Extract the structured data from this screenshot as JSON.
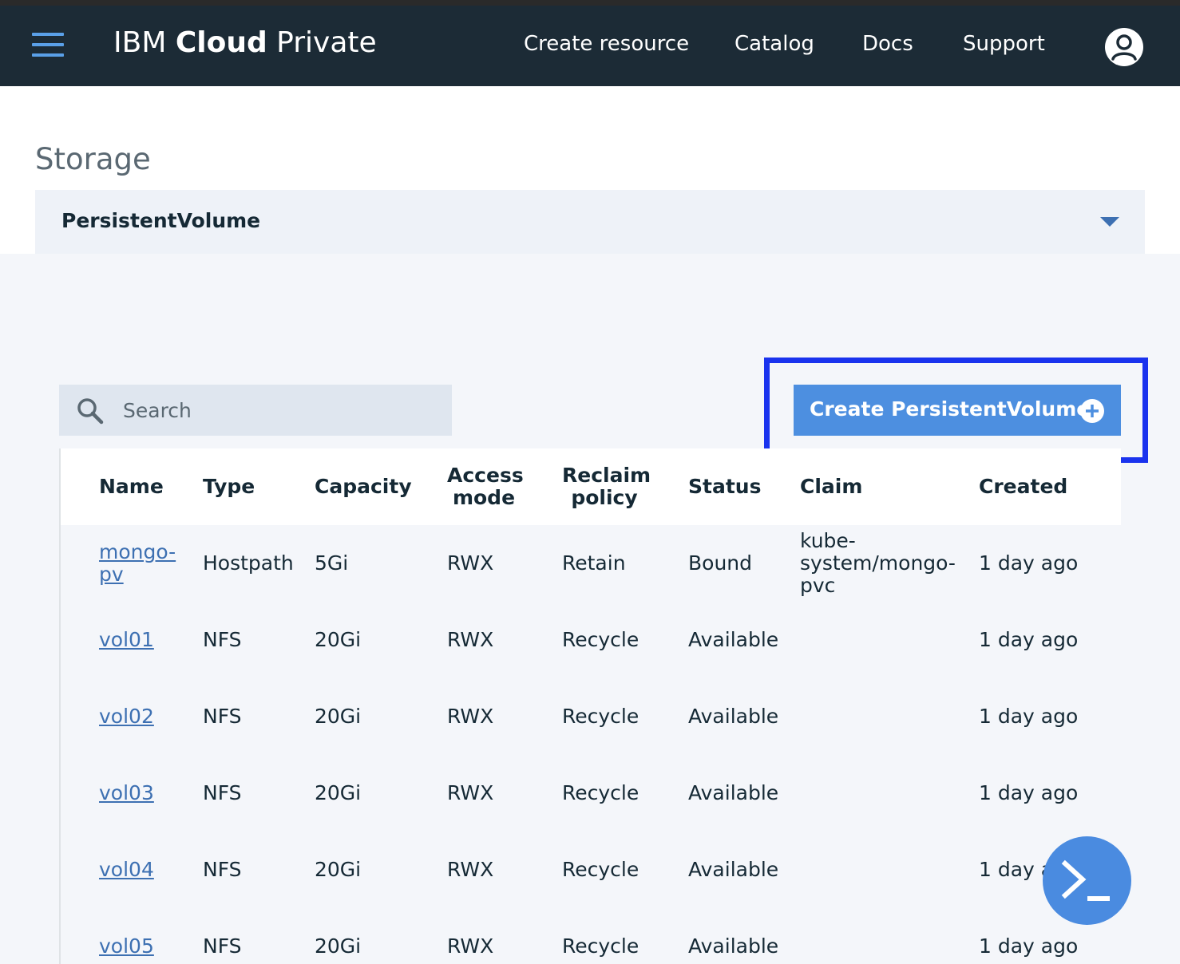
{
  "header": {
    "brand_prefix": "IBM ",
    "brand_bold": "Cloud",
    "brand_suffix": " Private",
    "nav": [
      "Create resource",
      "Catalog",
      "Docs",
      "Support"
    ]
  },
  "page": {
    "title": "Storage",
    "resource_selector": "PersistentVolume"
  },
  "search": {
    "placeholder": "Search"
  },
  "create_button": {
    "label": "Create PersistentVolume"
  },
  "table": {
    "columns": {
      "name": "Name",
      "type": "Type",
      "capacity": "Capacity",
      "access_mode_1": "Access",
      "access_mode_2": "mode",
      "reclaim_policy_1": "Reclaim",
      "reclaim_policy_2": "policy",
      "status": "Status",
      "claim": "Claim",
      "created": "Created"
    },
    "rows": [
      {
        "name1": "mongo-",
        "name2": "pv",
        "type": "Hostpath",
        "capacity": "5Gi",
        "access": "RWX",
        "reclaim": "Retain",
        "status": "Bound",
        "claim1": "kube-",
        "claim2": "system/mongo-",
        "claim3": "pvc",
        "created": "1 day ago"
      },
      {
        "name": "vol01",
        "type": "NFS",
        "capacity": "20Gi",
        "access": "RWX",
        "reclaim": "Recycle",
        "status": "Available",
        "created": "1 day ago"
      },
      {
        "name": "vol02",
        "type": "NFS",
        "capacity": "20Gi",
        "access": "RWX",
        "reclaim": "Recycle",
        "status": "Available",
        "created": "1 day ago"
      },
      {
        "name": "vol03",
        "type": "NFS",
        "capacity": "20Gi",
        "access": "RWX",
        "reclaim": "Recycle",
        "status": "Available",
        "created": "1 day ago"
      },
      {
        "name": "vol04",
        "type": "NFS",
        "capacity": "20Gi",
        "access": "RWX",
        "reclaim": "Recycle",
        "status": "Available",
        "created": "1 day a"
      },
      {
        "name": "vol05",
        "type": "NFS",
        "capacity": "20Gi",
        "access": "RWX",
        "reclaim": "Recycle",
        "status": "Available",
        "created": "1 day ago"
      }
    ]
  },
  "colors": {
    "header_bg": "#1c2b36",
    "accent": "#4d8fe0",
    "highlight_border": "#1a33ee",
    "link": "#3d70b2"
  },
  "icons": {
    "menu": "hamburger-menu-icon",
    "user": "user-avatar-icon",
    "search": "search-icon",
    "add": "plus-circle-icon",
    "dropdown": "caret-down-icon",
    "terminal": "terminal-icon"
  }
}
